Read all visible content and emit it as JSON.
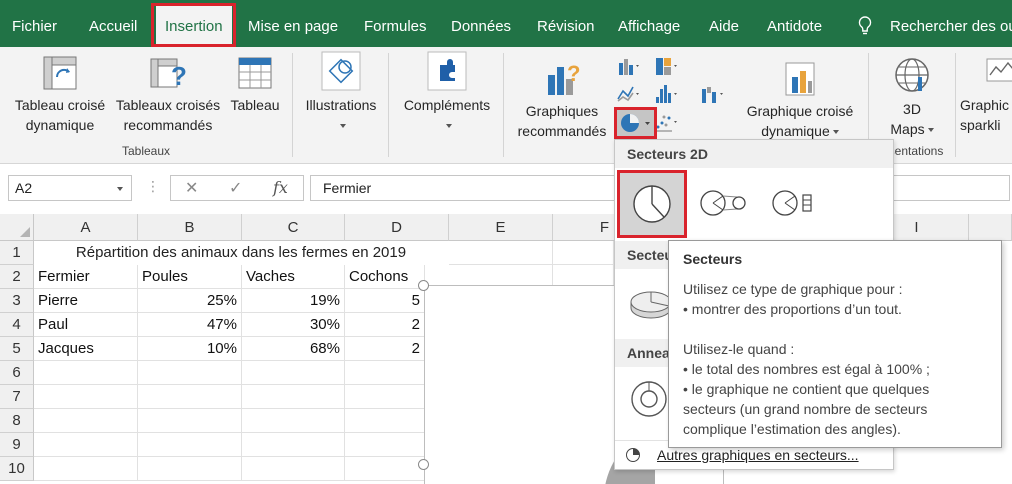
{
  "menu": {
    "tabs": [
      "Fichier",
      "Accueil",
      "Insertion",
      "Mise en page",
      "Formules",
      "Données",
      "Révision",
      "Affichage",
      "Aide",
      "Antidote"
    ],
    "active_tab": "Insertion",
    "search_label": "Rechercher des ou"
  },
  "ribbon": {
    "tableau_croise_line1": "Tableau croisé",
    "tableau_croise_line2": "dynamique",
    "tableaux_recommandes_line1": "Tableaux croisés",
    "tableaux_recommandes_line2": "recommandés",
    "tableau": "Tableau",
    "group_tableaux": "Tableaux",
    "illustrations": "Illustrations",
    "complements": "Compléments",
    "graphiques_line1": "Graphiques",
    "graphiques_line2": "recommandés",
    "graph_croise_line1": "Graphique croisé",
    "graph_croise_line2": "dynamique",
    "maps_line1": "3D",
    "maps_line2": "Maps",
    "group_presentations": "sentations",
    "sparkline_line1": "Graphic",
    "sparkline_line2": "sparkli"
  },
  "formula_bar": {
    "name_box": "A2",
    "fx": "fx",
    "value": "Fermier"
  },
  "sheet": {
    "columns": [
      "A",
      "B",
      "C",
      "D",
      "E",
      "F",
      "I"
    ],
    "rows": [
      "1",
      "2",
      "3",
      "4",
      "5",
      "6",
      "7",
      "8",
      "9",
      "10"
    ],
    "title": "Répartition des animaux dans les fermes en 2019",
    "headers": [
      "Fermier",
      "Poules",
      "Vaches",
      "Cochons"
    ],
    "data": [
      {
        "fermier": "Pierre",
        "poules": "25%",
        "vaches": "19%",
        "cochons": "5"
      },
      {
        "fermier": "Paul",
        "poules": "47%",
        "vaches": "30%",
        "cochons": "2"
      },
      {
        "fermier": "Jacques",
        "poules": "10%",
        "vaches": "68%",
        "cochons": "2"
      }
    ]
  },
  "gallery": {
    "section_2d": "Secteurs 2D",
    "section_3d": "Secteu",
    "section_anneau": "Annea",
    "more": "Autres graphiques en secteurs..."
  },
  "tooltip": {
    "title": "Secteurs",
    "line1": "Utilisez ce type de graphique pour :",
    "line2": "• montrer des proportions d’un tout.",
    "line3": "Utilisez-le quand :",
    "line4": "• le total des nombres est égal à 100% ;",
    "line5": "• le graphique ne contient que quelques",
    "line6": "secteurs (un grand nombre de secteurs",
    "line7": "complique l’estimation des angles)."
  },
  "colors": {
    "excel_green": "#217346",
    "highlight_red": "#d9232c",
    "pie_blue": "#2e75b6"
  }
}
